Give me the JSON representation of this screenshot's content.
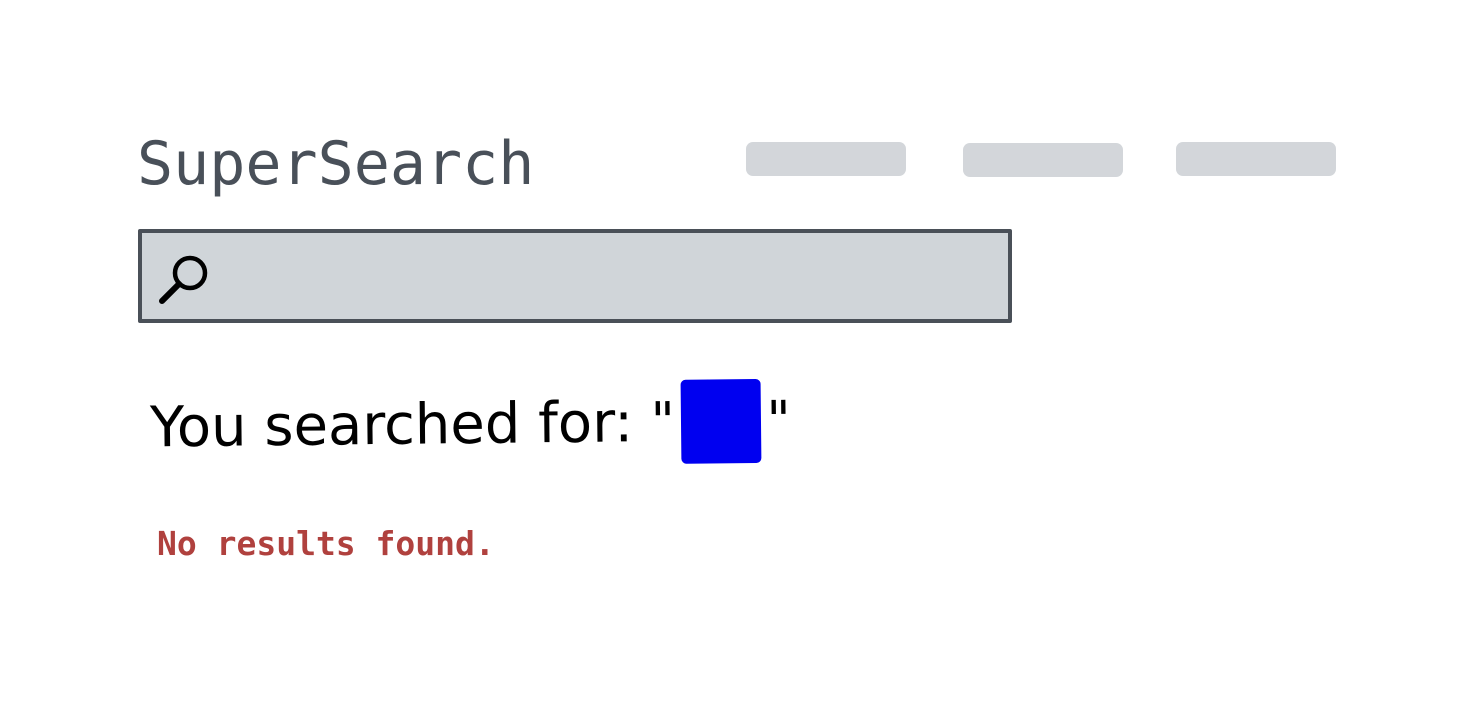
{
  "app": {
    "title": "SuperSearch"
  },
  "nav": {
    "items": [
      "",
      "",
      ""
    ]
  },
  "search": {
    "value": "",
    "placeholder": "",
    "icon": "search-icon"
  },
  "results": {
    "prefix": "You searched for: ",
    "quote_open": "\"",
    "quote_close": "\"",
    "query_display": "blue square",
    "query_color": "#0000f0",
    "message": "No results found.",
    "message_color": "#b0413e"
  }
}
